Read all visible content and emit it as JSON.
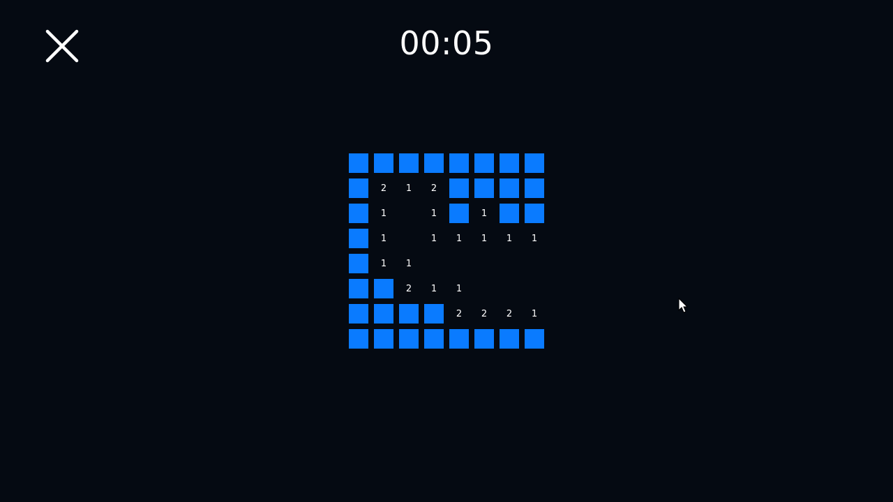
{
  "header": {
    "timer": "00:05",
    "close_icon": "close-icon"
  },
  "colors": {
    "background": "#050a12",
    "covered_cell": "#0a7bff",
    "text": "#ffffff"
  },
  "board": {
    "rows": 8,
    "cols": 8,
    "cells": [
      [
        "#",
        "#",
        "#",
        "#",
        "#",
        "#",
        "#",
        "#"
      ],
      [
        "#",
        "2",
        "1",
        "2",
        "#",
        "#",
        "#",
        "#"
      ],
      [
        "#",
        "1",
        "",
        "1",
        "#",
        "1",
        "#",
        "#"
      ],
      [
        "#",
        "1",
        "",
        "1",
        "1",
        "1",
        "1",
        "1"
      ],
      [
        "#",
        "1",
        "1",
        "",
        "",
        "",
        "",
        ""
      ],
      [
        "#",
        "#",
        "2",
        "1",
        "1",
        "",
        "",
        ""
      ],
      [
        "#",
        "#",
        "#",
        "#",
        "2",
        "2",
        "2",
        "1"
      ],
      [
        "#",
        "#",
        "#",
        "#",
        "#",
        "#",
        "#",
        "#"
      ]
    ]
  }
}
